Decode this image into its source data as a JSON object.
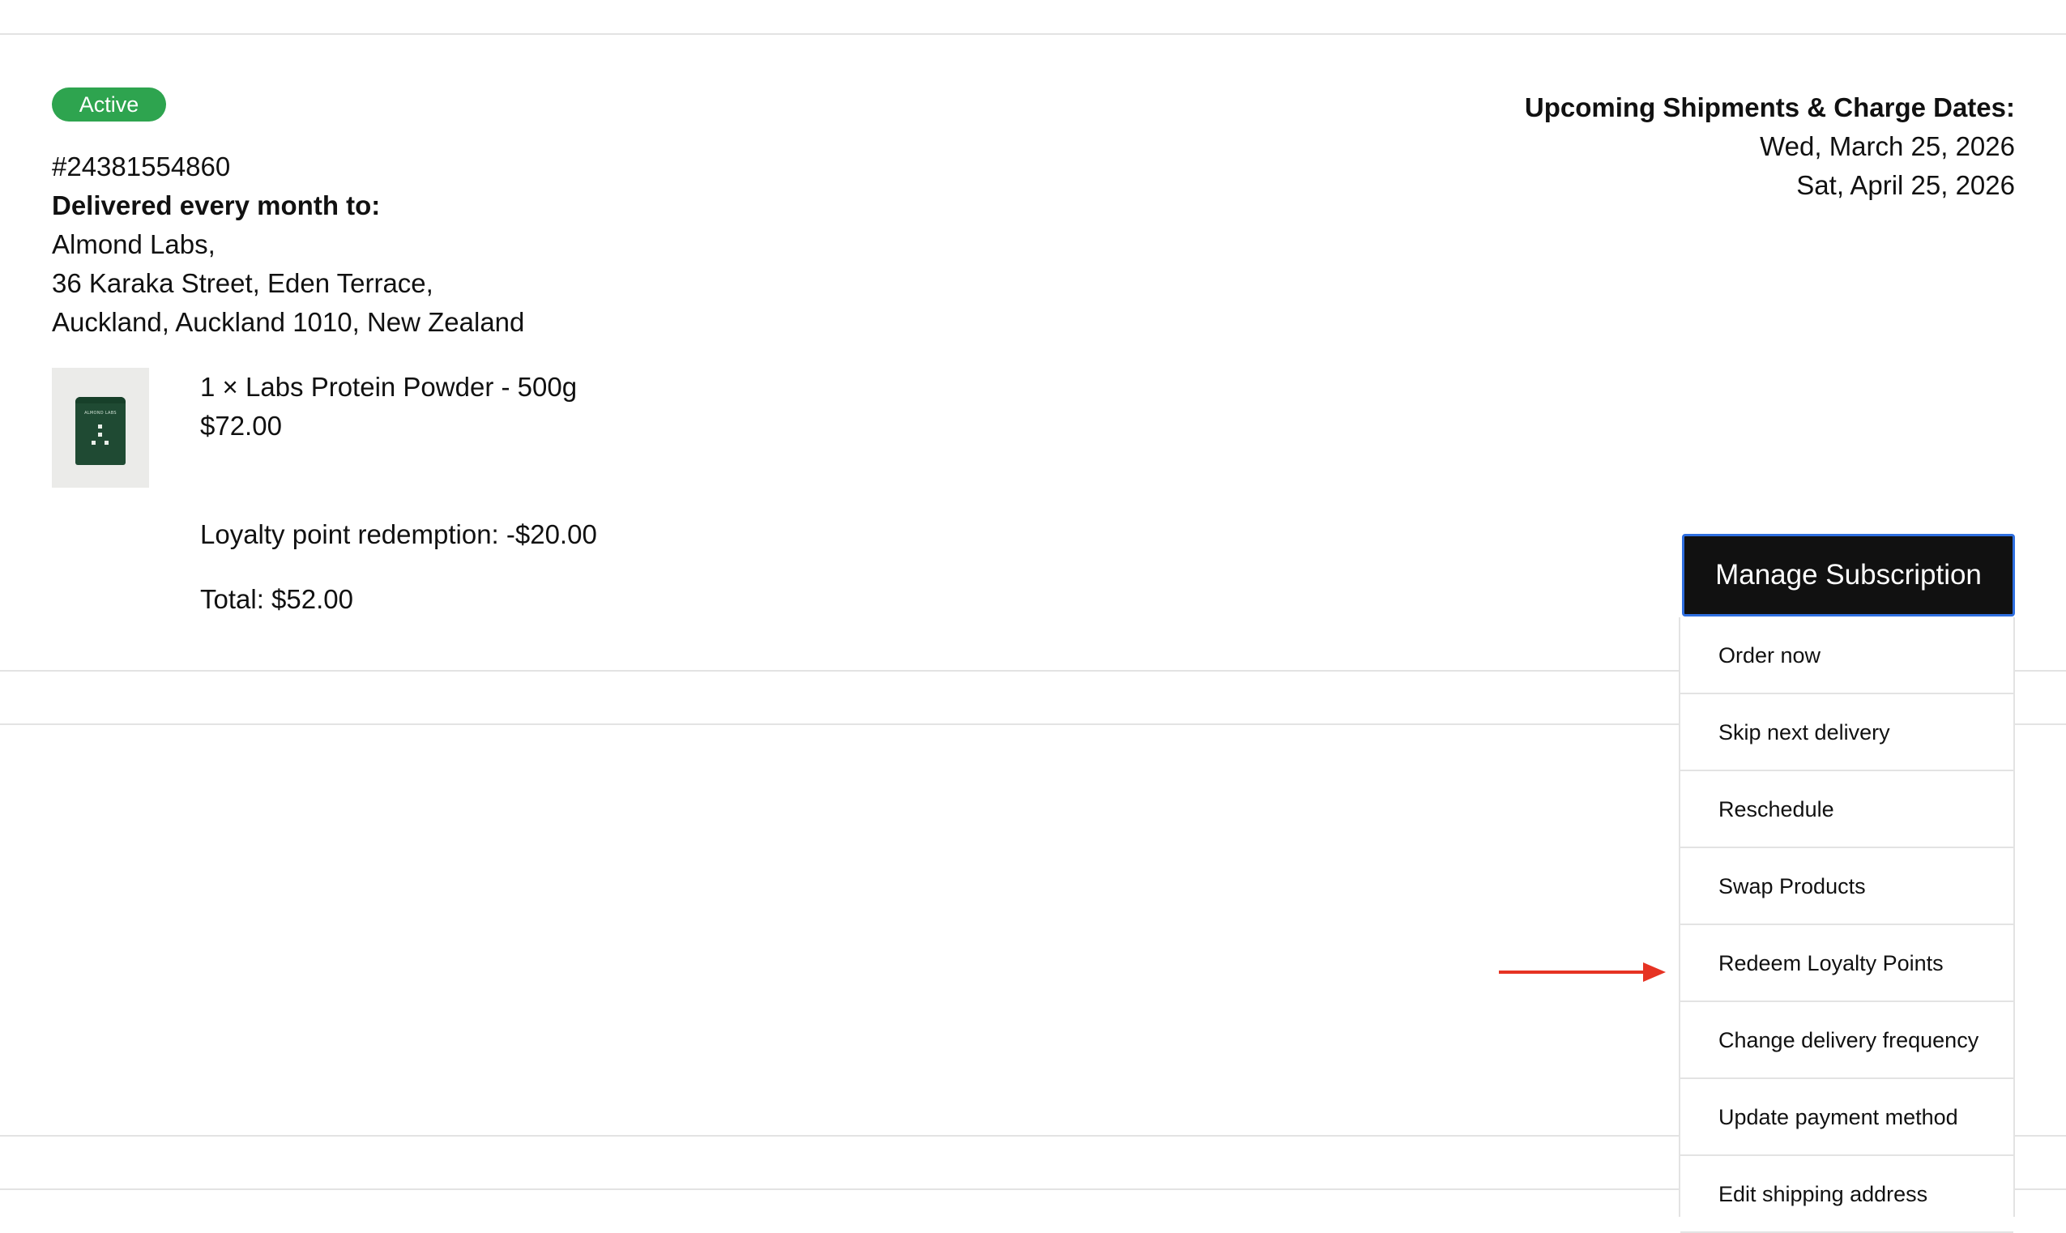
{
  "subscription": {
    "status_badge": "Active",
    "id": "#24381554860",
    "delivery_heading": "Delivered every month to:",
    "address": {
      "line1": "Almond Labs,",
      "line2": "36 Karaka Street, Eden Terrace,",
      "line3": "Auckland, Auckland 1010, New Zealand"
    },
    "item": {
      "description": "1 × Labs Protein Powder - 500g",
      "price": "$72.00",
      "image_label": "ALMOND LABS"
    },
    "loyalty_redemption": "Loyalty point redemption: -$20.00",
    "total": "Total: $52.00"
  },
  "shipments": {
    "heading": "Upcoming Shipments & Charge Dates:",
    "dates": [
      "Wed, March 25, 2026",
      "Sat, April 25, 2026"
    ]
  },
  "manage": {
    "button_label": "Manage Subscription",
    "menu_items": [
      "Order now",
      "Skip next delivery",
      "Reschedule",
      "Swap Products",
      "Redeem Loyalty Points",
      "Change delivery frequency",
      "Update payment method",
      "Edit shipping address"
    ]
  },
  "colors": {
    "badge_green": "#2ea44f",
    "button_black": "#111111",
    "focus_blue": "#2f6fe0",
    "arrow_red": "#e63323"
  }
}
